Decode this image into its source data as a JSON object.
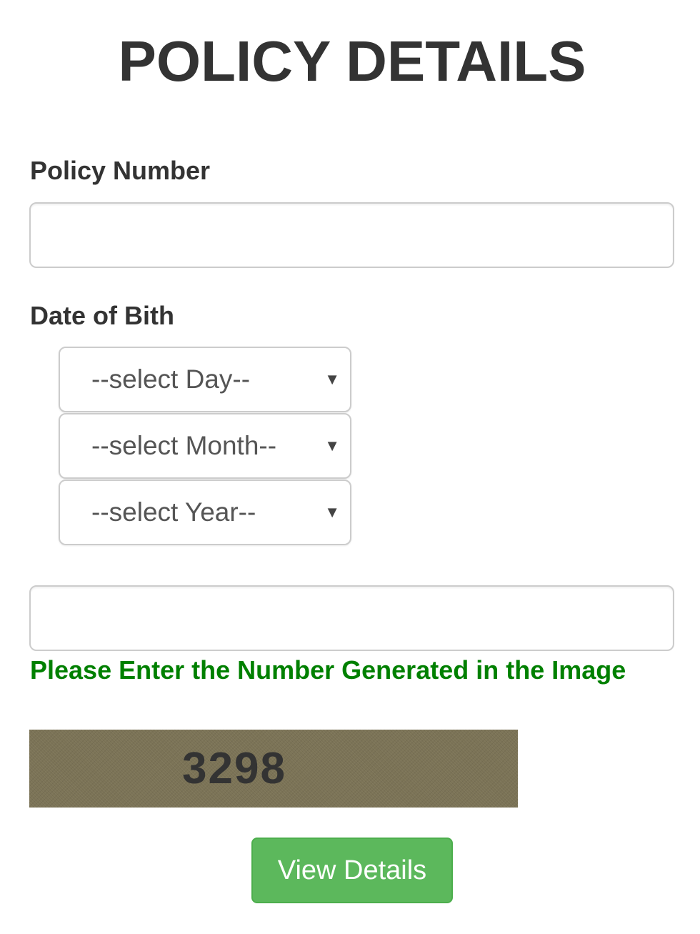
{
  "page": {
    "title": "POLICY DETAILS"
  },
  "policy_number": {
    "label": "Policy Number",
    "value": "",
    "placeholder": ""
  },
  "date_of_birth": {
    "label": "Date of Bith",
    "day": {
      "selected": "--select Day--"
    },
    "month": {
      "selected": "--select Month--"
    },
    "year": {
      "selected": "--select Year--"
    },
    "arrow_glyph": "▼"
  },
  "captcha": {
    "input_value": "",
    "help_text": "Please Enter the Number Generated in the Image",
    "code": "3298",
    "help_color": "#008000"
  },
  "actions": {
    "view_details_label": "View Details",
    "button_color": "#5cb85c"
  }
}
